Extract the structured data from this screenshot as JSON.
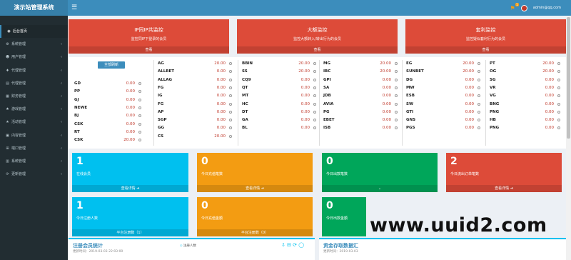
{
  "header": {
    "logo": "演示站管理系统",
    "menu_icon": "☰",
    "user": "admin@qq.com",
    "bell_count": "1"
  },
  "sidebar": {
    "items": [
      {
        "icon": "dashboard-icon",
        "glyph": "◉",
        "label": "后台首页"
      },
      {
        "icon": "gear-icon",
        "glyph": "⚙",
        "label": "系统管理"
      },
      {
        "icon": "users-icon",
        "glyph": "☻",
        "label": "用户管理"
      },
      {
        "icon": "tag-icon",
        "glyph": "♦",
        "label": "代理管理"
      },
      {
        "icon": "doc-icon",
        "glyph": "▤",
        "label": "代理管理"
      },
      {
        "icon": "money-icon",
        "glyph": "▦",
        "label": "财务管理"
      },
      {
        "icon": "game-icon",
        "glyph": "♠",
        "label": "游戏管理"
      },
      {
        "icon": "activity-icon",
        "glyph": "★",
        "label": "活动管理"
      },
      {
        "icon": "content-icon",
        "glyph": "▣",
        "label": "内容管理"
      },
      {
        "icon": "port-icon",
        "glyph": "⊞",
        "label": "端口管理"
      },
      {
        "icon": "log-icon",
        "glyph": "▥",
        "label": "系统管理"
      },
      {
        "icon": "update-icon",
        "glyph": "⟳",
        "label": "更新管理"
      }
    ]
  },
  "monitors": [
    {
      "title": "IP同IP共监控",
      "desc": "监控同IP下登录的会员",
      "foot": "查看"
    },
    {
      "title": "大额监控",
      "desc": "监控大额转入/转出行为的会员",
      "foot": "查看"
    },
    {
      "title": "套利监控",
      "desc": "监控疑似套利行为的会员",
      "foot": "查看"
    }
  ],
  "all_button": "全部刷新",
  "balances": [
    [
      {
        "name": "GD",
        "value": "0.00"
      },
      {
        "name": "PP",
        "value": "0.00"
      },
      {
        "name": "GJ",
        "value": "0.00"
      },
      {
        "name": "NEWE",
        "value": "0.00"
      },
      {
        "name": "BJ",
        "value": "0.00"
      },
      {
        "name": "CSK",
        "value": "0.00"
      },
      {
        "name": "RT",
        "value": "0.00"
      },
      {
        "name": "CSK",
        "value": "20.00"
      }
    ],
    [
      {
        "name": "AG",
        "value": "20.00"
      },
      {
        "name": "ALLBET",
        "value": "0.00"
      },
      {
        "name": "ALLAG",
        "value": "0.00"
      },
      {
        "name": "FG",
        "value": "0.00"
      },
      {
        "name": "IG",
        "value": "0.00"
      },
      {
        "name": "FG",
        "value": "0.00"
      },
      {
        "name": "AP",
        "value": "0.00"
      },
      {
        "name": "SGP",
        "value": "0.00"
      },
      {
        "name": "GG",
        "value": "0.00"
      },
      {
        "name": "CS",
        "value": "20.00"
      }
    ],
    [
      {
        "name": "BBIN",
        "value": "20.00"
      },
      {
        "name": "SS",
        "value": "20.00"
      },
      {
        "name": "CQ9",
        "value": "0.00"
      },
      {
        "name": "QT",
        "value": "0.00"
      },
      {
        "name": "MT",
        "value": "0.00"
      },
      {
        "name": "HC",
        "value": "0.00"
      },
      {
        "name": "DT",
        "value": "0.00"
      },
      {
        "name": "GA",
        "value": "0.00"
      },
      {
        "name": "BL",
        "value": "0.00"
      }
    ],
    [
      {
        "name": "MG",
        "value": "20.00"
      },
      {
        "name": "IBC",
        "value": "20.00"
      },
      {
        "name": "GPI",
        "value": "0.00"
      },
      {
        "name": "SA",
        "value": "0.00"
      },
      {
        "name": "JDB",
        "value": "0.00"
      },
      {
        "name": "AVIA",
        "value": "0.00"
      },
      {
        "name": "PG",
        "value": "0.00"
      },
      {
        "name": "EBET",
        "value": "0.00"
      },
      {
        "name": "ISB",
        "value": "0.00"
      }
    ],
    [
      {
        "name": "EG",
        "value": "20.00"
      },
      {
        "name": "SUNBET",
        "value": "20.00"
      },
      {
        "name": "DG",
        "value": "0.00"
      },
      {
        "name": "MW",
        "value": "0.00"
      },
      {
        "name": "ESB",
        "value": "0.00"
      },
      {
        "name": "SW",
        "value": "0.00"
      },
      {
        "name": "GTI",
        "value": "0.00"
      },
      {
        "name": "GNS",
        "value": "0.00"
      },
      {
        "name": "PGS",
        "value": "0.00"
      }
    ],
    [
      {
        "name": "PT",
        "value": "20.00"
      },
      {
        "name": "OG",
        "value": "20.00"
      },
      {
        "name": "SG",
        "value": "0.00"
      },
      {
        "name": "VR",
        "value": "0.00"
      },
      {
        "name": "VG",
        "value": "0.00"
      },
      {
        "name": "BNG",
        "value": "0.00"
      },
      {
        "name": "PNG",
        "value": "0.00"
      },
      {
        "name": "HB",
        "value": "0.00"
      },
      {
        "name": "PNG",
        "value": "0.00"
      }
    ]
  ],
  "stats": [
    {
      "num": "1",
      "label": "在线会员",
      "foot": "查看详情 ➜",
      "color": "#00c0ef"
    },
    {
      "num": "0",
      "label": "今日充值笔数",
      "foot": "查看详情 ➜",
      "color": "#f39c12"
    },
    {
      "num": "0",
      "label": "今日出款笔数",
      "foot": "⌄",
      "color": "#00a65a"
    },
    {
      "num": "2",
      "label": "今日流出订单笔数",
      "foot": "查看详情 ➜",
      "color": "#dd4b39"
    },
    {
      "num": "1",
      "label": "今日注册人数",
      "foot": "平台注册数（1）",
      "color": "#00c0ef"
    },
    {
      "num": "0",
      "label": "今日充值金额",
      "foot": "平台注册数（0）",
      "color": "#f39c12"
    },
    {
      "num": "0",
      "label": "今日出款金额",
      "foot": "",
      "color": "#00a65a"
    }
  ],
  "bottom": {
    "left_title": "注册会员统计",
    "left_time": "更新时间：2019-03-03 22:03:00",
    "legend": "注册人数",
    "right_title": "资金存取数据汇",
    "right_time": "更新时间：2019-03-03"
  },
  "watermark": "www.uuid2.com"
}
